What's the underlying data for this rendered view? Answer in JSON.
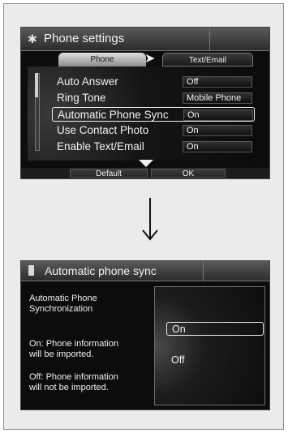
{
  "screen1": {
    "title": "Phone settings",
    "tabs": [
      {
        "label": "Phone"
      },
      {
        "label": "Text/Email"
      }
    ],
    "rows": [
      {
        "label": "Auto Answer",
        "value": "Off"
      },
      {
        "label": "Ring Tone",
        "value": "Mobile Phone"
      },
      {
        "label": "Automatic Phone Sync",
        "value": "On"
      },
      {
        "label": "Use Contact Photo",
        "value": "On"
      },
      {
        "label": "Enable Text/Email",
        "value": "On"
      }
    ],
    "buttons": {
      "default": "Default",
      "ok": "OK"
    }
  },
  "screen2": {
    "title": "Automatic phone sync",
    "description": {
      "heading": "Automatic Phone\nSynchronization",
      "on_text": "On: Phone information\nwill be imported.",
      "off_text": "Off: Phone information\nwill not be imported."
    },
    "options": [
      {
        "label": "On"
      },
      {
        "label": "Off"
      }
    ]
  }
}
